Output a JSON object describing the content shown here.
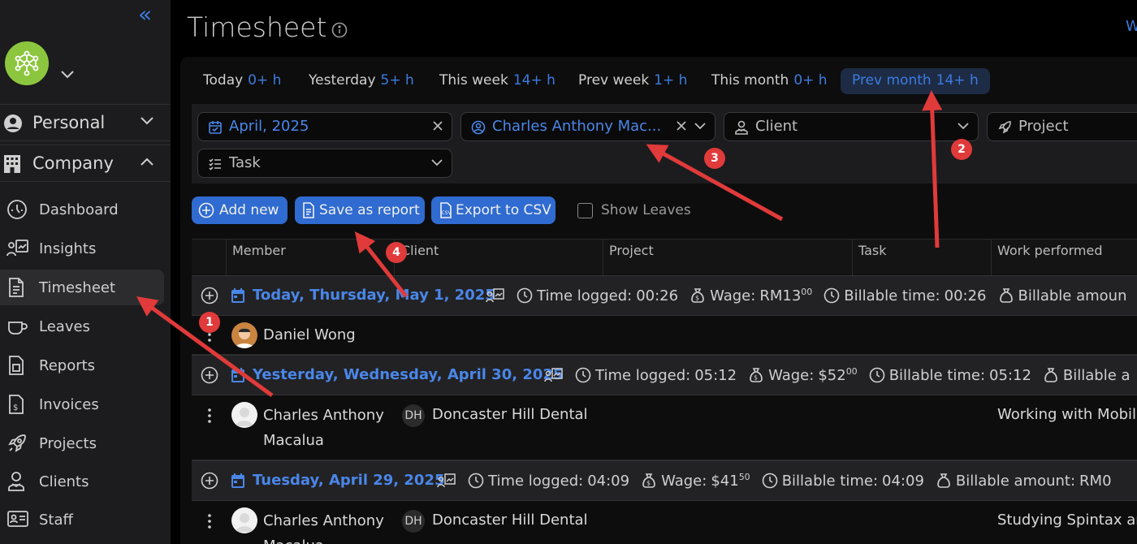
{
  "sidebar": {
    "sections": [
      {
        "label": "Personal",
        "icon": "user-circle-icon"
      },
      {
        "label": "Company",
        "icon": "building-icon"
      }
    ],
    "items": [
      {
        "label": "Dashboard",
        "icon": "gauge-icon"
      },
      {
        "label": "Insights",
        "icon": "insights-icon"
      },
      {
        "label": "Timesheet",
        "icon": "document-icon",
        "active": true
      },
      {
        "label": "Leaves",
        "icon": "coffee-cup-icon"
      },
      {
        "label": "Reports",
        "icon": "report-icon"
      },
      {
        "label": "Invoices",
        "icon": "invoice-icon"
      },
      {
        "label": "Projects",
        "icon": "rocket-icon"
      },
      {
        "label": "Clients",
        "icon": "client-icon"
      },
      {
        "label": "Staff",
        "icon": "id-card-icon"
      }
    ]
  },
  "header": {
    "title": "Timesheet",
    "top_right_link": "W"
  },
  "quick_filters": [
    {
      "label": "Today",
      "value": "0+ h"
    },
    {
      "label": "Yesterday",
      "value": "5+ h"
    },
    {
      "label": "This week",
      "value": "14+ h"
    },
    {
      "label": "Prev week",
      "value": "1+ h"
    },
    {
      "label": "This month",
      "value": "0+ h"
    },
    {
      "label": "Prev month",
      "value": "14+ h",
      "active": true
    }
  ],
  "filters": {
    "date": "April, 2025",
    "member": "Charles Anthony Mac...",
    "client_placeholder": "Client",
    "project_placeholder": "Project",
    "task_placeholder": "Task"
  },
  "actions": {
    "add_new": "Add new",
    "save_report": "Save as report",
    "export_csv": "Export to CSV",
    "show_leaves": "Show Leaves"
  },
  "table": {
    "columns": [
      "Member",
      "Client",
      "Project",
      "Task",
      "Work performed"
    ],
    "groups": [
      {
        "date": "Today, Thursday, May 1, 2025",
        "time_logged_label": "Time logged:",
        "time_logged": "00:26",
        "wage_label": "Wage:",
        "wage": "RM13",
        "wage_cents": "00",
        "billable_time_label": "Billable time:",
        "billable_time": "00:26",
        "billable_amount_label": "Billable amoun",
        "rows": [
          {
            "member": "Daniel Wong",
            "client_initials": "",
            "client": "",
            "work": ""
          }
        ]
      },
      {
        "date": "Yesterday, Wednesday, April 30, 2025",
        "time_logged_label": "Time logged:",
        "time_logged": "05:12",
        "wage_label": "Wage:",
        "wage": "$52",
        "wage_cents": "00",
        "billable_time_label": "Billable time:",
        "billable_time": "05:12",
        "billable_amount_label": "Billable a",
        "rows": [
          {
            "member_line1": "Charles Anthony",
            "member_line2": "Macalua",
            "client_initials": "DH",
            "client": "Doncaster Hill Dental",
            "work": "Working with Mobil"
          }
        ]
      },
      {
        "date": "Tuesday, April 29, 2025",
        "time_logged_label": "Time logged:",
        "time_logged": "04:09",
        "wage_label": "Wage:",
        "wage": "$41",
        "wage_cents": "50",
        "billable_time_label": "Billable time:",
        "billable_time": "04:09",
        "billable_amount_label": "Billable amount:",
        "billable_amount": "RM0",
        "rows": [
          {
            "member_line1": "Charles Anthony",
            "member_line2": "Macalua",
            "client_initials": "DH",
            "client": "Doncaster Hill Dental",
            "work": "Studying Spintax ar"
          }
        ]
      }
    ]
  },
  "annotations": [
    "1",
    "2",
    "3",
    "4"
  ],
  "colors": {
    "accent": "#3d7be0",
    "annotation": "#e03a3a",
    "logo": "#8cc63f"
  }
}
